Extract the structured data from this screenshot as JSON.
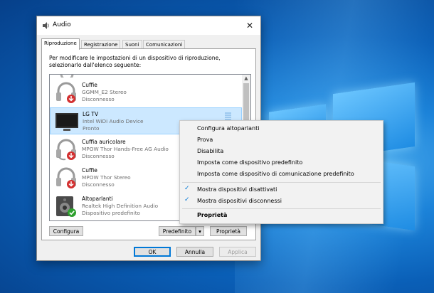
{
  "dialog": {
    "title": "Audio",
    "close": "✕",
    "tabs": [
      "Riproduzione",
      "Registrazione",
      "Suoni",
      "Comunicazioni"
    ],
    "description": "Per modificare le impostazioni di un dispositivo di riproduzione, selezionarlo dall'elenco seguente:",
    "devices": [
      {
        "name": "Cuffie",
        "detail": "GGMM_E2 Stereo",
        "status": "Disconnesso",
        "icon": "headphones-icon",
        "badge": "down-arrow"
      },
      {
        "name": "LG TV",
        "detail": "Intel WiDi Audio Device",
        "status": "Pronto",
        "icon": "tv-icon",
        "badge": ""
      },
      {
        "name": "Cuffia auricolare",
        "detail": "MPOW Thor Hands-Free AG Audio",
        "status": "Disconnesso",
        "icon": "headset-icon",
        "badge": "down-arrow"
      },
      {
        "name": "Cuffie",
        "detail": "MPOW Thor Stereo",
        "status": "Disconnesso",
        "icon": "headphones-icon",
        "badge": "down-arrow"
      },
      {
        "name": "Altoparlanti",
        "detail": "Realtek High Definition Audio",
        "status": "Dispositivo predefinito",
        "icon": "speaker-icon",
        "badge": "check"
      }
    ],
    "buttons": {
      "configure": "Configura",
      "default": "Predefinito",
      "dropdown": "▾",
      "properties": "Proprietà",
      "ok": "OK",
      "cancel": "Annulla",
      "apply": "Applica"
    }
  },
  "context_menu": {
    "items": [
      {
        "label": "Configura altoparlanti",
        "checked": false,
        "bold": false
      },
      {
        "label": "Prova",
        "checked": false,
        "bold": false
      },
      {
        "label": "Disabilita",
        "checked": false,
        "bold": false
      },
      {
        "label": "Imposta come dispositivo predefinito",
        "checked": false,
        "bold": false
      },
      {
        "label": "Imposta come dispositivo di comunicazione predefinito",
        "checked": false,
        "bold": false
      },
      {
        "label": "Mostra dispositivi disattivati",
        "checked": true,
        "bold": false
      },
      {
        "label": "Mostra dispositivi disconnessi",
        "checked": true,
        "bold": false
      },
      {
        "label": "Proprietà",
        "checked": false,
        "bold": true
      }
    ],
    "check_glyph": "✓"
  },
  "colors": {
    "accent": "#0078d7",
    "selection": "#cce8ff",
    "disconnected_badge": "#d32f2f",
    "default_badge": "#2fa12f"
  }
}
